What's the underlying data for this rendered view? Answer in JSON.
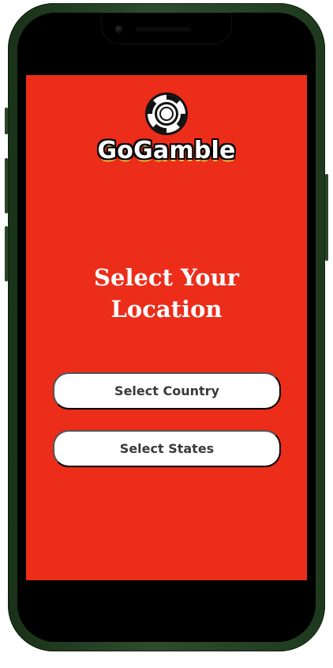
{
  "app": {
    "brand": "GoGamble",
    "title_line1": "Select Your",
    "title_line2": "Location"
  },
  "buttons": {
    "country_label": "Select Country",
    "states_label": "Select States"
  },
  "icons": {
    "logo": "poker-chip-icon"
  },
  "colors": {
    "background": "#ec2d1a",
    "button": "#ffffff",
    "title": "#ffffff",
    "logo_outline": "#000000",
    "logo_shadow": "#f2c23d"
  }
}
